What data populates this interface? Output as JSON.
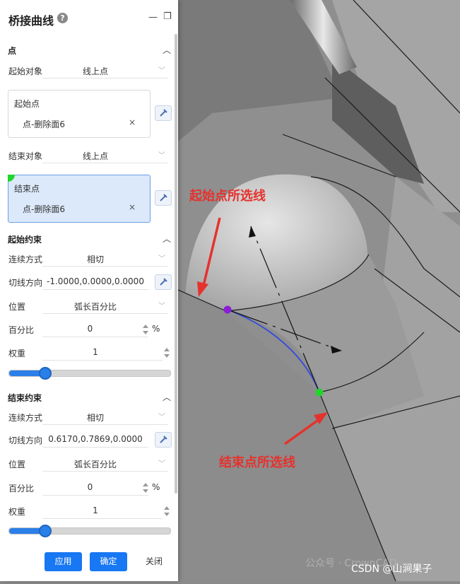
{
  "dialog": {
    "title": "桥接曲线",
    "help_glyph": "?",
    "minimize_glyph": "—",
    "restore_glyph": "❐"
  },
  "point_section": {
    "header": "点",
    "start_object_label": "起始对象",
    "start_object_value": "线上点",
    "start_point_label": "起始点",
    "start_point_value": "点-删除面6",
    "start_marker_color": "#8a1fd6",
    "end_object_label": "结束对象",
    "end_object_value": "线上点",
    "end_point_label": "结束点",
    "end_point_value": "点-删除面6",
    "end_marker_color": "#1fd62a",
    "clear_glyph": "×"
  },
  "start_constraint": {
    "header": "起始约束",
    "continuity_label": "连续方式",
    "continuity_value": "相切",
    "tangent_label": "切线方向",
    "tangent_value": "-1.0000,0.0000,0.0000",
    "position_label": "位置",
    "position_value": "弧长百分比",
    "percent_label": "百分比",
    "percent_value": "0",
    "percent_unit": "%",
    "weight_label": "权重",
    "weight_value": "1",
    "weight_slider_fraction": 0.22
  },
  "end_constraint": {
    "header": "结束约束",
    "continuity_label": "连续方式",
    "continuity_value": "相切",
    "tangent_label": "切线方向",
    "tangent_value": "0.6170,0.7869,0.0000",
    "position_label": "位置",
    "position_value": "弧长百分比",
    "percent_label": "百分比",
    "percent_value": "0",
    "percent_unit": "%",
    "weight_label": "权重",
    "weight_value": "1",
    "weight_slider_fraction": 0.22
  },
  "footer": {
    "apply_label": "应用",
    "ok_label": "确定",
    "close_label": "关闭"
  },
  "viewport": {
    "start_annotation": "起始点所选线",
    "end_annotation": "结束点所选线",
    "annotation_color": "#e5322d",
    "watermark_wechat": "公众号 · CrownCAD",
    "watermark_csdn": "CSDN @山涧果子"
  }
}
